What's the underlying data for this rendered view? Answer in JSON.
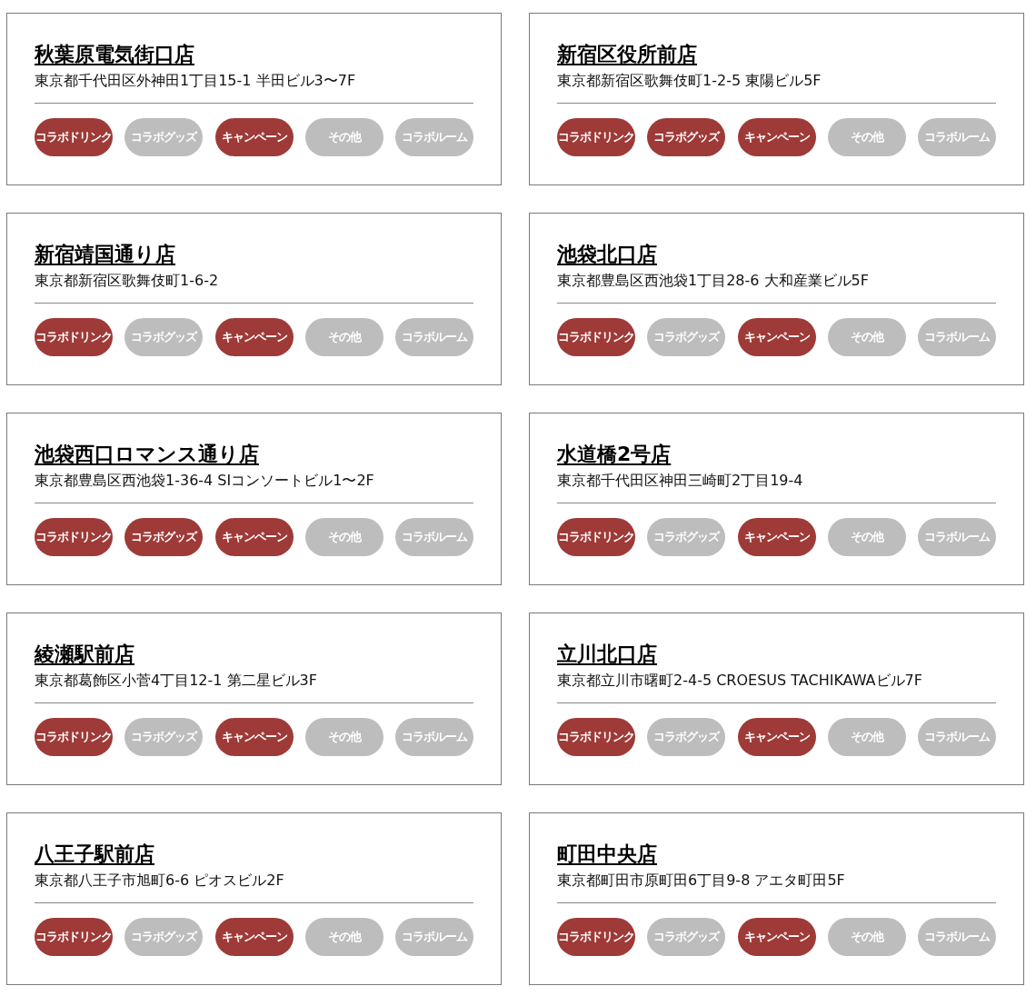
{
  "stores": [
    {
      "name": "秋葉原電気街口店",
      "address": "東京都千代田区外神田1丁目15-1 半田ビル3〜7F",
      "tags": [
        {
          "label": "コラボドリンク",
          "on": true
        },
        {
          "label": "コラボグッズ",
          "on": false
        },
        {
          "label": "キャンペーン",
          "on": true
        },
        {
          "label": "その他",
          "on": false
        },
        {
          "label": "コラボルーム",
          "on": false
        }
      ]
    },
    {
      "name": "新宿区役所前店",
      "address": "東京都新宿区歌舞伎町1-2-5 東陽ビル5F",
      "tags": [
        {
          "label": "コラボドリンク",
          "on": true
        },
        {
          "label": "コラボグッズ",
          "on": true
        },
        {
          "label": "キャンペーン",
          "on": true
        },
        {
          "label": "その他",
          "on": false
        },
        {
          "label": "コラボルーム",
          "on": false
        }
      ]
    },
    {
      "name": "新宿靖国通り店",
      "address": "東京都新宿区歌舞伎町1-6-2",
      "tags": [
        {
          "label": "コラボドリンク",
          "on": true
        },
        {
          "label": "コラボグッズ",
          "on": false
        },
        {
          "label": "キャンペーン",
          "on": true
        },
        {
          "label": "その他",
          "on": false
        },
        {
          "label": "コラボルーム",
          "on": false
        }
      ]
    },
    {
      "name": "池袋北口店",
      "address": "東京都豊島区西池袋1丁目28-6 大和産業ビル5F",
      "tags": [
        {
          "label": "コラボドリンク",
          "on": true
        },
        {
          "label": "コラボグッズ",
          "on": false
        },
        {
          "label": "キャンペーン",
          "on": true
        },
        {
          "label": "その他",
          "on": false
        },
        {
          "label": "コラボルーム",
          "on": false
        }
      ]
    },
    {
      "name": "池袋西口ロマンス通り店",
      "address": "東京都豊島区西池袋1-36-4 SIコンソートビル1〜2F",
      "tags": [
        {
          "label": "コラボドリンク",
          "on": true
        },
        {
          "label": "コラボグッズ",
          "on": true
        },
        {
          "label": "キャンペーン",
          "on": true
        },
        {
          "label": "その他",
          "on": false
        },
        {
          "label": "コラボルーム",
          "on": false
        }
      ]
    },
    {
      "name": "水道橋2号店",
      "address": "東京都千代田区神田三崎町2丁目19-4",
      "tags": [
        {
          "label": "コラボドリンク",
          "on": true
        },
        {
          "label": "コラボグッズ",
          "on": false
        },
        {
          "label": "キャンペーン",
          "on": true
        },
        {
          "label": "その他",
          "on": false
        },
        {
          "label": "コラボルーム",
          "on": false
        }
      ]
    },
    {
      "name": "綾瀬駅前店",
      "address": "東京都葛飾区小菅4丁目12-1 第二星ビル3F",
      "tags": [
        {
          "label": "コラボドリンク",
          "on": true
        },
        {
          "label": "コラボグッズ",
          "on": false
        },
        {
          "label": "キャンペーン",
          "on": true
        },
        {
          "label": "その他",
          "on": false
        },
        {
          "label": "コラボルーム",
          "on": false
        }
      ]
    },
    {
      "name": "立川北口店",
      "address": "東京都立川市曙町2-4-5 CROESUS TACHIKAWAビル7F",
      "tags": [
        {
          "label": "コラボドリンク",
          "on": true
        },
        {
          "label": "コラボグッズ",
          "on": false
        },
        {
          "label": "キャンペーン",
          "on": true
        },
        {
          "label": "その他",
          "on": false
        },
        {
          "label": "コラボルーム",
          "on": false
        }
      ]
    },
    {
      "name": "八王子駅前店",
      "address": "東京都八王子市旭町6-6 ピオスビル2F",
      "tags": [
        {
          "label": "コラボドリンク",
          "on": true
        },
        {
          "label": "コラボグッズ",
          "on": false
        },
        {
          "label": "キャンペーン",
          "on": true
        },
        {
          "label": "その他",
          "on": false
        },
        {
          "label": "コラボルーム",
          "on": false
        }
      ]
    },
    {
      "name": "町田中央店",
      "address": "東京都町田市原町田6丁目9-8 アエタ町田5F",
      "tags": [
        {
          "label": "コラボドリンク",
          "on": true
        },
        {
          "label": "コラボグッズ",
          "on": false
        },
        {
          "label": "キャンペーン",
          "on": true
        },
        {
          "label": "その他",
          "on": false
        },
        {
          "label": "コラボルーム",
          "on": false
        }
      ]
    }
  ]
}
